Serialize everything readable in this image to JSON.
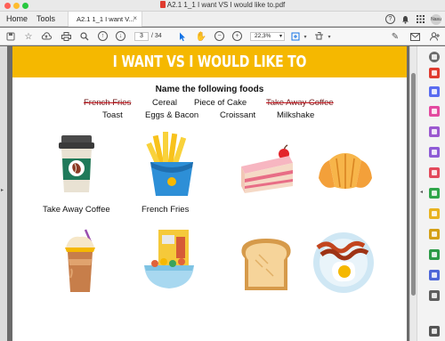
{
  "window": {
    "title": "A2.1 1_1 I want VS I would like to.pdf"
  },
  "tabs": {
    "home": "Home",
    "tools": "Tools",
    "document": "A2.1 1_1 I want V...",
    "close": "×"
  },
  "account": {
    "initials": "Nasu"
  },
  "toolbar": {
    "page_current": "3",
    "page_total": "/ 34",
    "zoom": "22,3%"
  },
  "document": {
    "banner_title": "I WANT VS I WOULD LIKE TO",
    "instruction": "Name the following foods",
    "word_bank": [
      {
        "text": "French Fries",
        "struck": true
      },
      {
        "text": "Cereal",
        "struck": false
      },
      {
        "text": "Piece of Cake",
        "struck": false
      },
      {
        "text": "Take Away Coffee",
        "struck": true
      },
      {
        "text": "Toast",
        "struck": false
      },
      {
        "text": "Eggs & Bacon",
        "struck": false
      },
      {
        "text": "Croissant",
        "struck": false
      },
      {
        "text": "Milkshake",
        "struck": false
      }
    ],
    "captions": {
      "coffee": "Take Away Coffee",
      "fries": "French Fries"
    }
  },
  "colors": {
    "banner": "#f5b800",
    "strike": "#c0141c",
    "accent": "#1473e6"
  },
  "icons": [
    "save-icon",
    "bookmark-star-icon",
    "upload-icon",
    "print-icon",
    "zoom-out-icon",
    "page-up-icon",
    "page-down-icon",
    "zoom-out-circle-icon",
    "zoom-in-circle-icon",
    "select-arrow-icon",
    "hand-icon",
    "fit-page-icon",
    "scan-icon",
    "edit-icon",
    "mail-icon",
    "user-add-icon"
  ]
}
